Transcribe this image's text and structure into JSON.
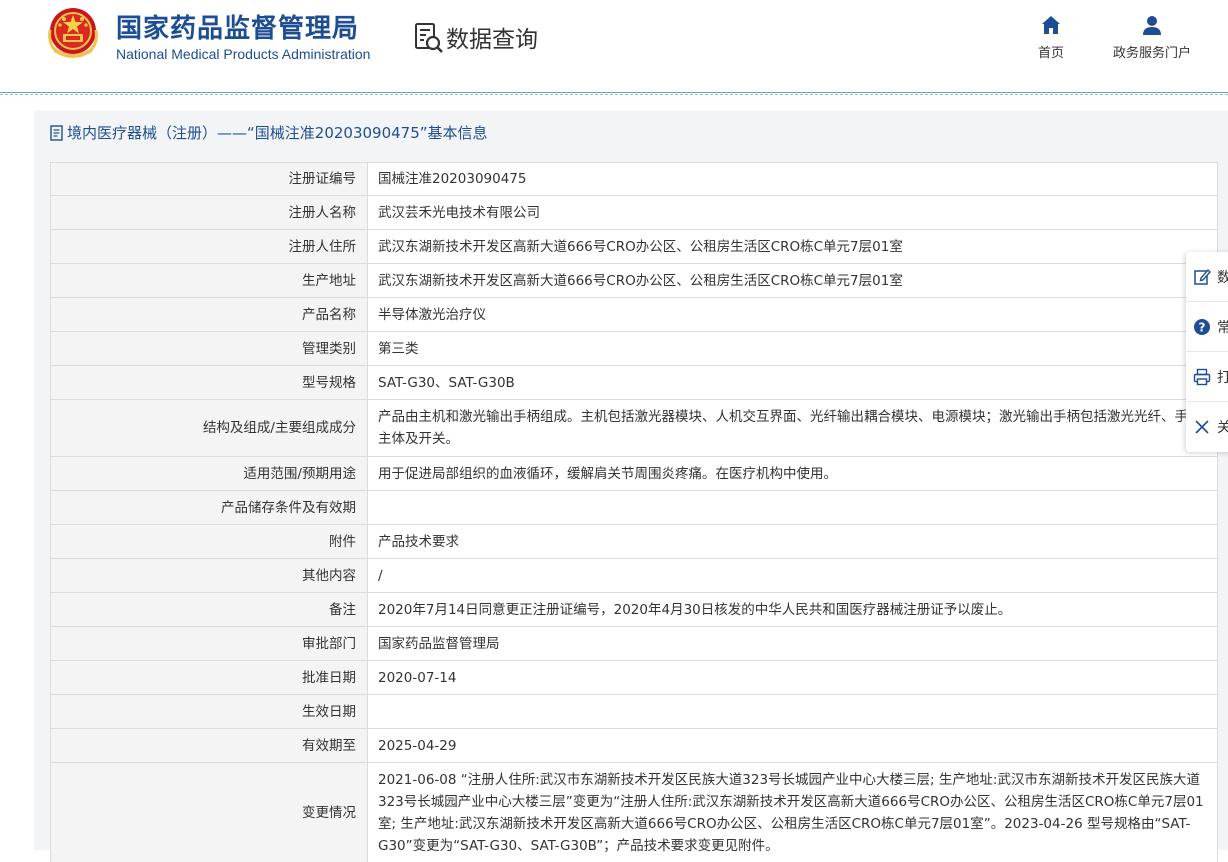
{
  "header": {
    "org_name_cn": "国家药品监督管理局",
    "org_name_en": "National Medical Products Administration",
    "query_title": "数据查询",
    "nav": [
      {
        "label": "首页",
        "icon": "home-icon"
      },
      {
        "label": "政务服务门户",
        "icon": "user-icon"
      }
    ]
  },
  "panel": {
    "title": "境内医疗器械（注册）——“国械注准20203090475”基本信息"
  },
  "details": [
    {
      "label": "注册证编号",
      "value": "国械注准20203090475"
    },
    {
      "label": "注册人名称",
      "value": "武汉芸禾光电技术有限公司"
    },
    {
      "label": "注册人住所",
      "value": "武汉东湖新技术开发区高新大道666号CRO办公区、公租房生活区CRO栋C单元7层01室"
    },
    {
      "label": "生产地址",
      "value": "武汉东湖新技术开发区高新大道666号CRO办公区、公租房生活区CRO栋C单元7层01室"
    },
    {
      "label": "产品名称",
      "value": "半导体激光治疗仪"
    },
    {
      "label": "管理类别",
      "value": "第三类"
    },
    {
      "label": "型号规格",
      "value": "SAT-G30、SAT-G30B"
    },
    {
      "label": "结构及组成/主要组成成分",
      "value": "产品由主机和激光输出手柄组成。主机包括激光器模块、人机交互界面、光纤输出耦合模块、电源模块；激光输出手柄包括激光光纤、手柄主体及开关。"
    },
    {
      "label": "适用范围/预期用途",
      "value": "用于促进局部组织的血液循环，缓解肩关节周围炎疼痛。在医疗机构中使用。"
    },
    {
      "label": "产品储存条件及有效期",
      "value": ""
    },
    {
      "label": "附件",
      "value": "产品技术要求"
    },
    {
      "label": "其他内容",
      "value": "/"
    },
    {
      "label": "备注",
      "value": "2020年7月14日同意更正注册证编号，2020年4月30日核发的中华人民共和国医疗器械注册证予以废止。"
    },
    {
      "label": "审批部门",
      "value": "国家药品监督管理局"
    },
    {
      "label": "批准日期",
      "value": "2020-07-14"
    },
    {
      "label": "生效日期",
      "value": ""
    },
    {
      "label": "有效期至",
      "value": "2025-04-29"
    },
    {
      "label": "变更情况",
      "value": "2021-06-08 “注册人住所:武汉市东湖新技术开发区民族大道323号长城园产业中心大楼三层; 生产地址:武汉市东湖新技术开发区民族大道323号长城园产业中心大楼三层”变更为“注册人住所:武汉东湖新技术开发区高新大道666号CRO办公区、公租房生活区CRO栋C单元7层01室; 生产地址:武汉东湖新技术开发区高新大道666号CRO办公区、公租房生活区CRO栋C单元7层01室”。2023-04-26 型号规格由“SAT-G30”变更为“SAT-G30、SAT-G30B”；产品技术要求变更见附件。"
    }
  ],
  "side_tools": [
    {
      "label": "数",
      "icon": "edit-icon"
    },
    {
      "label": "常",
      "icon": "help-icon"
    },
    {
      "label": "打",
      "icon": "print-icon"
    },
    {
      "label": "关",
      "icon": "close-icon"
    }
  ],
  "colors": {
    "brand_blue": "#1d4e94",
    "key_cell_bg": "#f4f4f4",
    "panel_bg": "#f3f4f6"
  }
}
